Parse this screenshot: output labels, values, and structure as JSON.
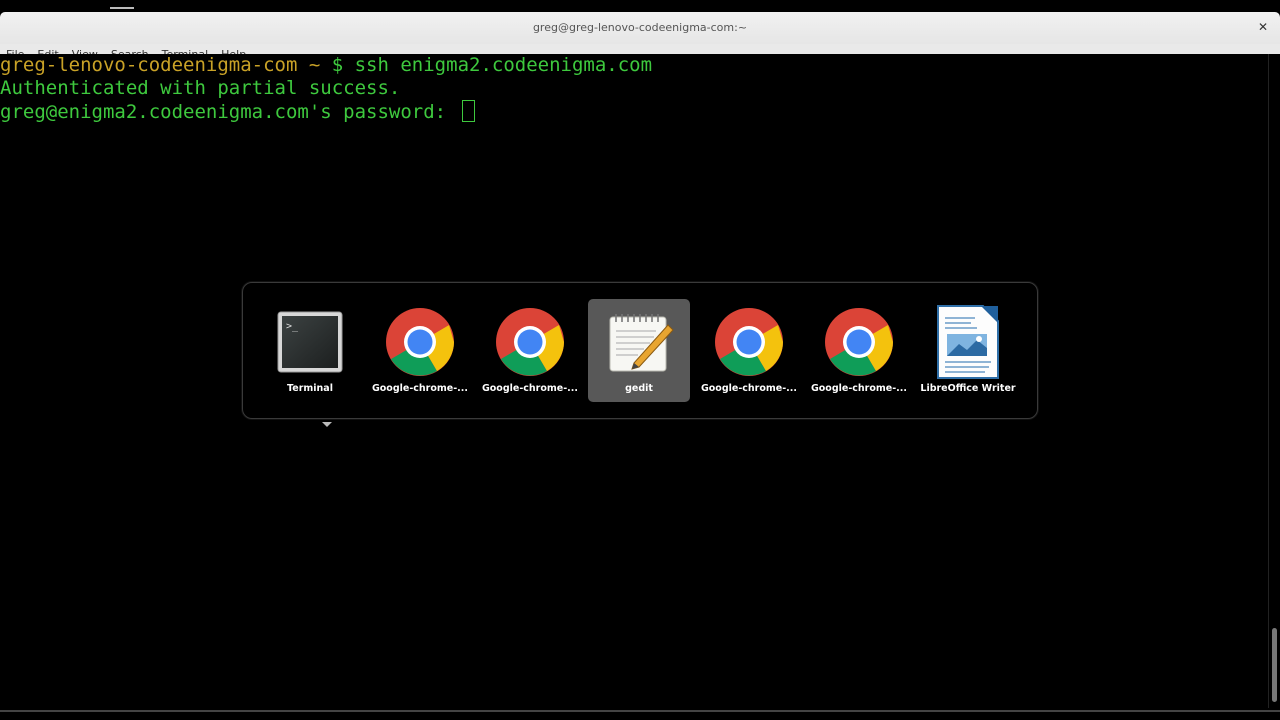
{
  "window": {
    "title": "greg@greg-lenovo-codeenigma-com:~",
    "close_glyph": "✕"
  },
  "menu": {
    "items": [
      "File",
      "Edit",
      "View",
      "Search",
      "Terminal",
      "Help"
    ]
  },
  "terminal": {
    "prompt_host": "greg-lenovo-codeenigma-com ~",
    "prompt_cmd": " $ ssh enigma2.codeenigma.com",
    "line2": "Authenticated with partial success.",
    "line3": "greg@enigma2.codeenigma.com's password: "
  },
  "switcher": {
    "apps": [
      {
        "label": "Terminal",
        "icon": "terminal-icon",
        "selected": false
      },
      {
        "label": "Google-chrome-...",
        "icon": "chrome-icon",
        "selected": false
      },
      {
        "label": "Google-chrome-...",
        "icon": "chrome-icon",
        "selected": false
      },
      {
        "label": "gedit",
        "icon": "gedit-icon",
        "selected": true
      },
      {
        "label": "Google-chrome-...",
        "icon": "chrome-icon",
        "selected": false
      },
      {
        "label": "Google-chrome-...",
        "icon": "chrome-icon",
        "selected": false
      },
      {
        "label": "LibreOffice Writer",
        "icon": "libreoffice-writer-icon",
        "selected": false
      }
    ]
  },
  "colors": {
    "prompt_host": "#c9a227",
    "terminal_text": "#3ec93e",
    "selected_app_bg": "#585858"
  }
}
